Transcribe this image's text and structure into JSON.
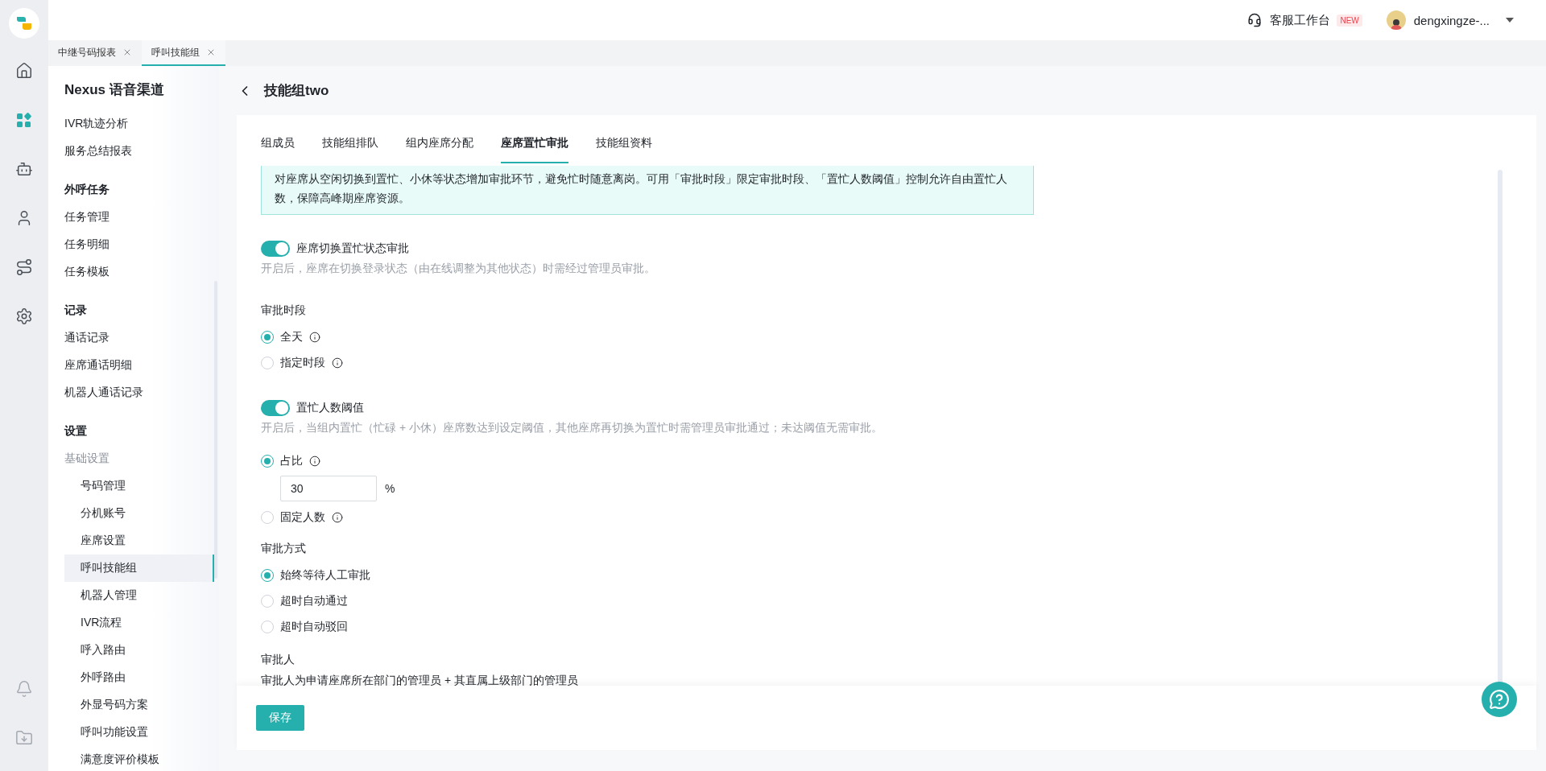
{
  "top_bar": {
    "service_desk": {
      "label": "客服工作台",
      "badge": "NEW"
    },
    "user": {
      "name": "dengxingze-..."
    }
  },
  "rail": [
    {
      "kind": "home",
      "selected": false
    },
    {
      "kind": "apps",
      "selected": true
    },
    {
      "kind": "robot",
      "selected": false
    },
    {
      "kind": "person",
      "selected": false
    },
    {
      "kind": "route",
      "selected": false
    },
    {
      "kind": "settings",
      "selected": false
    },
    {
      "kind": "bell",
      "selected": false
    },
    {
      "kind": "download",
      "selected": false
    }
  ],
  "page_tabs": [
    {
      "label": "中继号码报表",
      "selected": false
    },
    {
      "label": "呼叫技能组",
      "selected": true
    }
  ],
  "sidebar": {
    "title": "Nexus 语音渠道",
    "sections": [
      {
        "items": [
          {
            "label": "IVR轨迹分析",
            "selected": false
          },
          {
            "label": "服务总结报表",
            "selected": false
          }
        ]
      },
      {
        "heading": "外呼任务",
        "items": [
          {
            "label": "任务管理",
            "selected": false
          },
          {
            "label": "任务明细",
            "selected": false
          },
          {
            "label": "任务模板",
            "selected": false
          }
        ]
      },
      {
        "heading": "记录",
        "items": [
          {
            "label": "通话记录",
            "selected": false
          },
          {
            "label": "座席通话明细",
            "selected": false
          },
          {
            "label": "机器人通话记录",
            "selected": false
          }
        ]
      },
      {
        "heading": "设置",
        "items": [
          {
            "label": "基础设置",
            "selected": false,
            "children": [
              {
                "label": "号码管理",
                "selected": false
              },
              {
                "label": "分机账号",
                "selected": false
              },
              {
                "label": "座席设置",
                "selected": false
              },
              {
                "label": "呼叫技能组",
                "selected": true
              },
              {
                "label": "机器人管理",
                "selected": false
              },
              {
                "label": "IVR流程",
                "selected": false
              },
              {
                "label": "呼入路由",
                "selected": false
              },
              {
                "label": "外呼路由",
                "selected": false
              },
              {
                "label": "外显号码方案",
                "selected": false
              },
              {
                "label": "呼叫功能设置",
                "selected": false
              },
              {
                "label": "满意度评价模板",
                "selected": false
              }
            ]
          }
        ]
      }
    ]
  },
  "page": {
    "title": "技能组two"
  },
  "tabs": [
    {
      "label": "组成员",
      "selected": false
    },
    {
      "label": "技能组排队",
      "selected": false
    },
    {
      "label": "组内座席分配",
      "selected": false
    },
    {
      "label": "座席置忙审批",
      "selected": true
    },
    {
      "label": "技能组资料",
      "selected": false
    }
  ],
  "notice": "对座席从空闲切换到置忙、小休等状态增加审批环节，避免忙时随意离岗。可用「审批时段」限定审批时段、「置忙人数阈值」控制允许自由置忙人数，保障高峰期座席资源。",
  "busy_approval": {
    "label": "座席切换置忙状态审批",
    "on": true,
    "description": "开启后，座席在切换登录状态（由在线调整为其他状态）时需经过管理员审批。"
  },
  "approval_period": {
    "label": "审批时段",
    "options": [
      {
        "label": "全天",
        "selected": true,
        "info": true
      },
      {
        "label": "指定时段",
        "selected": false,
        "info": true
      }
    ]
  },
  "busy_threshold": {
    "label": "置忙人数阈值",
    "on": true,
    "description": "开启后，当组内置忙（忙碌 + 小休）座席数达到设定阈值，其他座席再切换为置忙时需管理员审批通过；未达阈值无需审批。",
    "options": [
      {
        "label": "占比",
        "selected": true,
        "info": true,
        "value": "30",
        "unit": "%"
      },
      {
        "label": "固定人数",
        "selected": false,
        "info": true
      }
    ]
  },
  "approval_method": {
    "label": "审批方式",
    "options": [
      {
        "label": "始终等待人工审批",
        "selected": true
      },
      {
        "label": "超时自动通过",
        "selected": false
      },
      {
        "label": "超时自动驳回",
        "selected": false
      }
    ]
  },
  "approver": {
    "label": "审批人",
    "text": "审批人为申请座席所在部门的管理员 + 其直属上级部门的管理员"
  },
  "save_button": "保存"
}
